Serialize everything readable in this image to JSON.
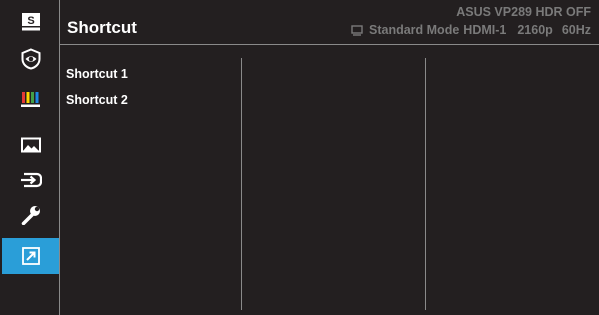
{
  "sidebar": {
    "items": [
      {
        "name": "splendid",
        "icon": "splendid-s-icon",
        "active": false
      },
      {
        "name": "eye-care",
        "icon": "eye-shield-icon",
        "active": false
      },
      {
        "name": "color",
        "icon": "color-bars-icon",
        "active": false
      },
      {
        "name": "image",
        "icon": "landscape-image-icon",
        "active": false
      },
      {
        "name": "input-select",
        "icon": "input-arrow-icon",
        "active": false
      },
      {
        "name": "system-setup",
        "icon": "wrench-icon",
        "active": false
      },
      {
        "name": "shortcut",
        "icon": "shortcut-arrow-icon",
        "active": true
      }
    ],
    "active_color": "#2a9ed8"
  },
  "header": {
    "title": "Shortcut",
    "model": "ASUS  VP289 HDR OFF",
    "mode": "Standard Mode",
    "input": "HDMI-1",
    "resolution": "2160p",
    "refresh": "60Hz"
  },
  "options": [
    "Shortcut 1",
    "Shortcut 2"
  ],
  "colors": {
    "background": "#231f20",
    "text": "#ffffff",
    "status_text": "#7a7a7a",
    "divider": "#8a8a8a"
  }
}
